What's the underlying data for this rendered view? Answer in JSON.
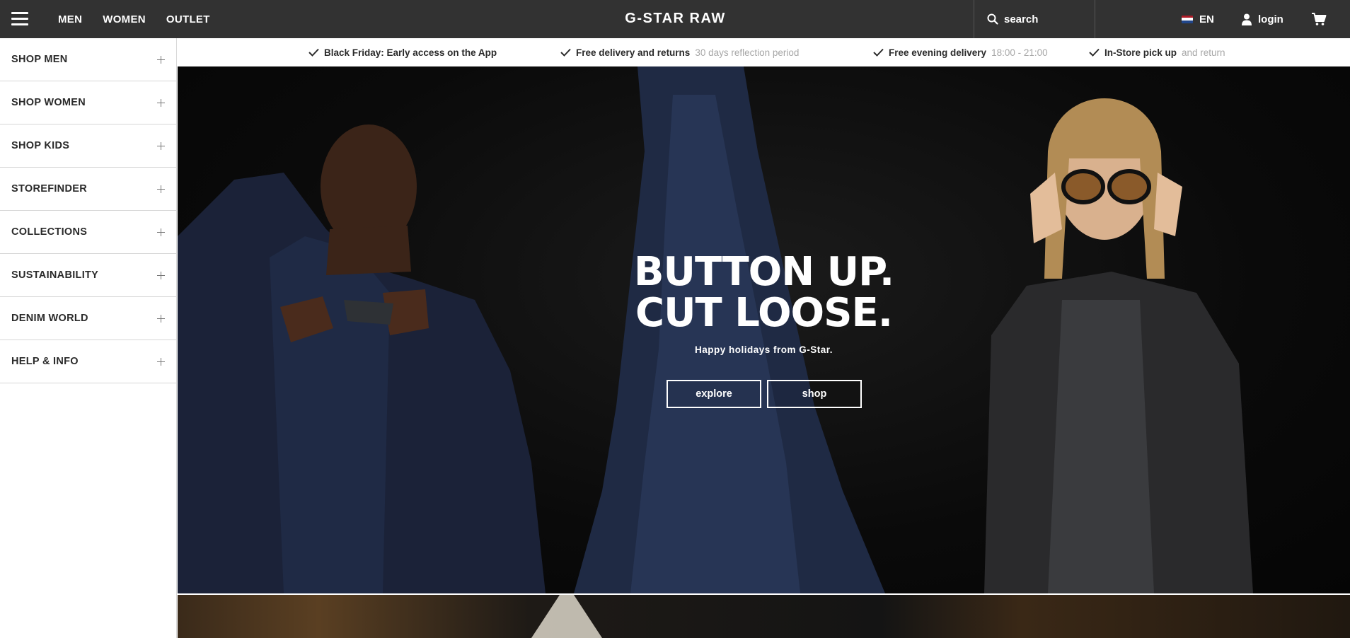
{
  "header": {
    "nav": [
      "MEN",
      "WOMEN",
      "OUTLET"
    ],
    "logo": "G-STAR RAW",
    "search_label": "search",
    "language": "EN",
    "login_label": "login"
  },
  "sidebar": {
    "items": [
      {
        "label": "SHOP MEN"
      },
      {
        "label": "SHOP WOMEN"
      },
      {
        "label": "SHOP KIDS"
      },
      {
        "label": "STOREFINDER"
      },
      {
        "label": "COLLECTIONS"
      },
      {
        "label": "SUSTAINABILITY"
      },
      {
        "label": "DENIM WORLD"
      },
      {
        "label": "HELP & INFO"
      }
    ]
  },
  "usps": [
    {
      "strong": "Black Friday: Early access on the App",
      "light": ""
    },
    {
      "strong": "Free delivery and returns",
      "light": "30 days reflection period"
    },
    {
      "strong": "Free evening delivery",
      "light": "18:00 - 21:00"
    },
    {
      "strong": "In-Store pick up",
      "light": "and return"
    }
  ],
  "hero": {
    "title_line1": "BUTTON UP.",
    "title_line2": "CUT LOOSE.",
    "subtitle": "Happy holidays from G-Star.",
    "buttons": [
      "explore",
      "shop"
    ]
  },
  "colors": {
    "header_bg": "#323232",
    "hero_bg": "#0b0b0b",
    "flag": [
      "#ae1c28",
      "#ffffff",
      "#21468b"
    ]
  }
}
